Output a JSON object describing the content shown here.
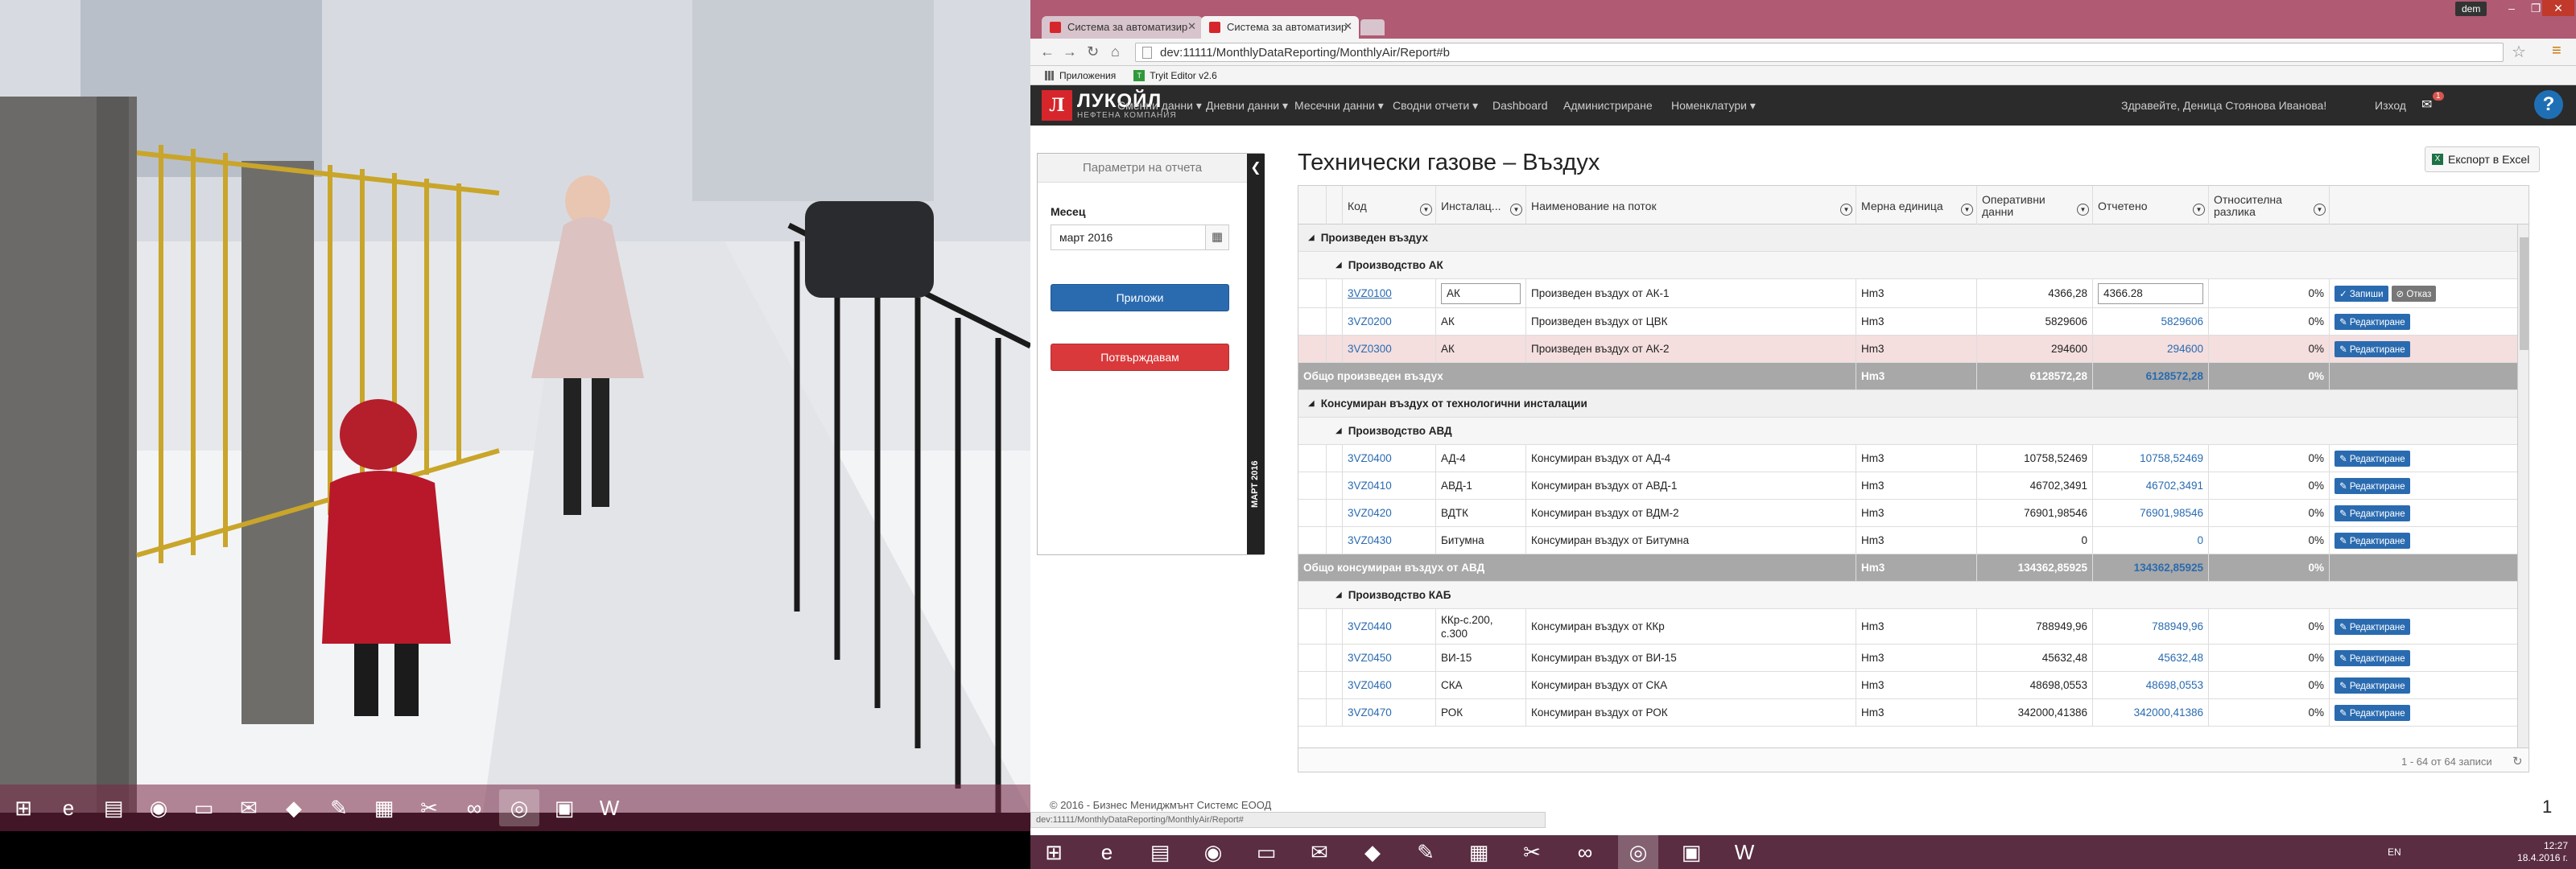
{
  "taskbar_left_icons": [
    "start-icon",
    "ie-icon",
    "files-icon",
    "firefox-icon",
    "folder-icon",
    "outlook-icon",
    "app-icon",
    "paint-icon",
    "calc-icon",
    "tools-icon",
    "vs-icon",
    "chrome-icon",
    "remote-icon",
    "word-icon"
  ],
  "browser": {
    "tabs": [
      {
        "label": "Система за автоматизир",
        "active": false
      },
      {
        "label": "Система за автоматизир",
        "active": true
      }
    ],
    "user_button": "dem",
    "url": "dev:11111/MonthlyDataReporting/MonthlyAir/Report#b",
    "bookmarks": [
      "Приложения",
      "Tryit Editor v2.6"
    ]
  },
  "site": {
    "logo_title": "ЛУКОЙЛ",
    "logo_subtitle": "НЕФТЕНА КОМПАНИЯ",
    "nav": [
      "Сменни данни ▾",
      "Дневни данни ▾",
      "Месечни данни ▾",
      "Сводни отчети ▾",
      "Dashboard",
      "Администриране",
      "Номенклатури ▾"
    ],
    "greeting": "Здравейте, Деница Стоянова Иванова!",
    "logout": "Изход",
    "mail_count": "1",
    "help": "?"
  },
  "params": {
    "header": "Параметри на отчета",
    "month_label": "Месец",
    "month_value": "март 2016",
    "apply_button": "Приложи",
    "confirm_button": "Потвърждавам",
    "vertical_label": "МАРТ 2016"
  },
  "report": {
    "title": "Технически газове – Въздух",
    "export_label": "Експорт в Excel",
    "columns": [
      "Код",
      "Инсталац...",
      "Наименование на поток",
      "Мерна единица",
      "Оперативни данни",
      "Отчетено",
      "Относителна разлика"
    ],
    "pager": "1 - 64 от 64 записи",
    "buttons": {
      "edit": "Редактиране",
      "save": "Запиши",
      "cancel": "Отказ"
    },
    "rows": [
      {
        "kind": "g1",
        "label": "Произведен въздух"
      },
      {
        "kind": "g2",
        "label": "Производство АК"
      },
      {
        "kind": "edit",
        "code": "3VZ0100",
        "inst": "АК",
        "name": "Произведен въздух от АК-1",
        "unit": "Нm3",
        "op": "4366,28",
        "rep": "4366.28",
        "diff": "0%"
      },
      {
        "kind": "data",
        "code": "3VZ0200",
        "inst": "АК",
        "name": "Произведен въздух от ЦВК",
        "unit": "Нm3",
        "op": "5829606",
        "rep": "5829606",
        "diff": "0%"
      },
      {
        "kind": "data",
        "hl": true,
        "code": "3VZ0300",
        "inst": "АК",
        "name": "Произведен въздух от АК-2",
        "unit": "Нm3",
        "op": "294600",
        "rep": "294600",
        "diff": "0%"
      },
      {
        "kind": "total",
        "label": "Общо произведен въздух",
        "unit": "Нm3",
        "op": "6128572,28",
        "rep": "6128572,28",
        "diff": "0%"
      },
      {
        "kind": "g1",
        "label": "Консумиран въздух от технологични инсталации"
      },
      {
        "kind": "g2",
        "label": "Производство АВД"
      },
      {
        "kind": "data",
        "code": "3VZ0400",
        "inst": "АД-4",
        "name": "Консумиран въздух от АД-4",
        "unit": "Нm3",
        "op": "10758,52469",
        "rep": "10758,52469",
        "diff": "0%"
      },
      {
        "kind": "data",
        "code": "3VZ0410",
        "inst": "АВД-1",
        "name": "Консумиран въздух от АВД-1",
        "unit": "Нm3",
        "op": "46702,3491",
        "rep": "46702,3491",
        "diff": "0%"
      },
      {
        "kind": "data",
        "code": "3VZ0420",
        "inst": "ВДТК",
        "name": "Консумиран въздух от ВДМ-2",
        "unit": "Нm3",
        "op": "76901,98546",
        "rep": "76901,98546",
        "diff": "0%"
      },
      {
        "kind": "data",
        "code": "3VZ0430",
        "inst": "Битумна",
        "name": "Консумиран въздух от Битумна",
        "unit": "Нm3",
        "op": "0",
        "rep": "0",
        "diff": "0%"
      },
      {
        "kind": "total",
        "label": "Общо консумиран въздух от АВД",
        "unit": "Нm3",
        "op": "134362,85925",
        "rep": "134362,85925",
        "diff": "0%"
      },
      {
        "kind": "g2",
        "label": "Производство КАБ"
      },
      {
        "kind": "data",
        "tall": true,
        "code": "3VZ0440",
        "inst": "ККр-с.200, с.300",
        "name": "Консумиран въздух от ККр",
        "unit": "Нm3",
        "op": "788949,96",
        "rep": "788949,96",
        "diff": "0%"
      },
      {
        "kind": "data",
        "code": "3VZ0450",
        "inst": "ВИ-15",
        "name": "Консумиран въздух от ВИ-15",
        "unit": "Нm3",
        "op": "45632,48",
        "rep": "45632,48",
        "diff": "0%"
      },
      {
        "kind": "data",
        "code": "3VZ0460",
        "inst": "СКА",
        "name": "Консумиран въздух от СКА",
        "unit": "Нm3",
        "op": "48698,0553",
        "rep": "48698,0553",
        "diff": "0%"
      },
      {
        "kind": "data",
        "code": "3VZ0470",
        "inst": "РОК",
        "name": "Консумиран въздух от РОК",
        "unit": "Нm3",
        "op": "342000,41386",
        "rep": "342000,41386",
        "diff": "0%"
      }
    ]
  },
  "footer": "© 2016 - Бизнес Мениджмънт Системс ЕООД",
  "status_url": "dev:11111/MonthlyDataReporting/MonthlyAir/Report#",
  "page_number": "1",
  "tray": {
    "lang": "EN",
    "time": "12:27",
    "date": "18.4.2016 г."
  },
  "colors": {
    "brand_red": "#d6262b",
    "link_blue": "#2a6bb0",
    "taskbar": "#5a2d42",
    "nav_dark": "#2b2b2b"
  }
}
